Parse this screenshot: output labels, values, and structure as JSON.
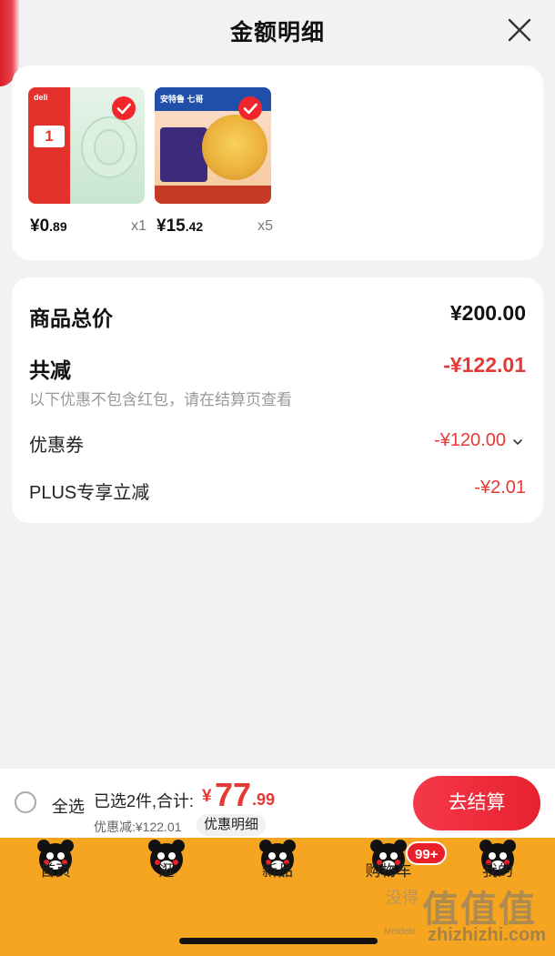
{
  "header": {
    "title": "金额明细",
    "close_icon": "close-icon"
  },
  "products": [
    {
      "name": "deli tape",
      "thumb_text": "deli",
      "badge_number": "1",
      "price_yen": "¥0",
      "price_cents": ".89",
      "qty": "x1"
    },
    {
      "name": "egg tart",
      "thumb_text": "安特鲁 七哥",
      "price_yen": "¥15",
      "price_cents": ".42",
      "qty": "x5"
    }
  ],
  "summary": {
    "total_label": "商品总价",
    "total_value": "¥200.00",
    "reduce_label": "共减",
    "reduce_value": "-¥122.01",
    "note": "以下优惠不包含红包，请在结算页查看",
    "coupon_label": "优惠券",
    "coupon_value": "-¥120.00",
    "plus_label": "PLUS专享立减",
    "plus_value": "-¥2.01"
  },
  "checkout": {
    "select_all": "全选",
    "selected_text": "已选2件,合计:",
    "yen": "¥",
    "total_int": "77",
    "total_dec": ".99",
    "discount_text": "优惠减:¥122.01",
    "detail_chip": "优惠明细",
    "button": "去结算"
  },
  "tabs": [
    {
      "label": "首页",
      "icon": "bear-mascot-icon"
    },
    {
      "label": "逛",
      "icon": "bear-mascot-icon"
    },
    {
      "label": "新品",
      "icon": "bear-mascot-icon"
    },
    {
      "label": "购物车",
      "icon": "bear-mascot-icon",
      "badge": "99+"
    },
    {
      "label": "我的",
      "icon": "bear-mascot-icon"
    }
  ],
  "watermark": {
    "big": "值值值",
    "small": "没得",
    "url": "zhizhizhi.com",
    "url2": "Meidebi"
  },
  "colors": {
    "accent_red": "#e53935",
    "tabbar": "#f5a520",
    "button_red": "#ec2633"
  }
}
